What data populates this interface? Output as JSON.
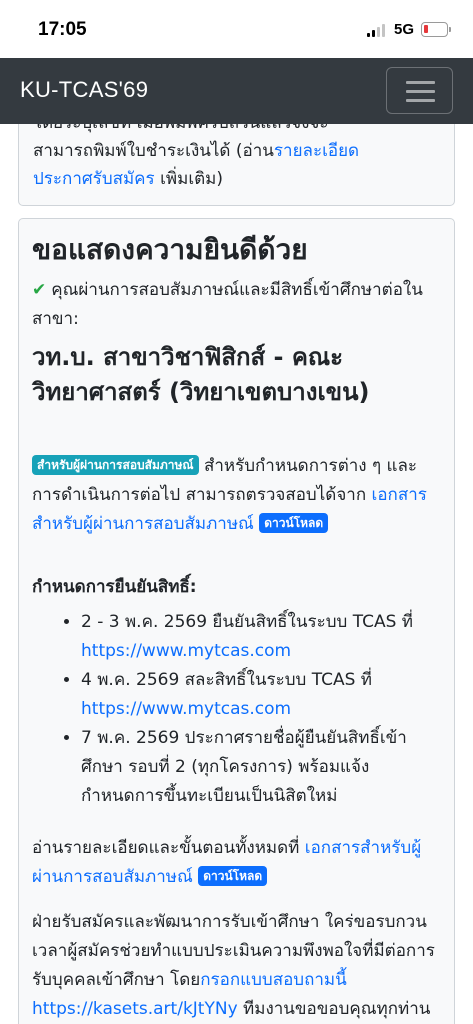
{
  "status": {
    "time": "17:05",
    "network": "5G"
  },
  "navbar": {
    "brand": "KU-TCAS'69"
  },
  "notice": {
    "line1": "โดยระบุเลขที่ เมื่อพิมพ์ครบถ้วนแล้วจึงจะ",
    "line2_pre": "สามารถพิมพ์ใบชำระเงินได้ (อ่าน",
    "line2_link": "รายละเอียด",
    "line3_link": "ประกาศรับสมัคร",
    "line3_post": " เพิ่มเติม)"
  },
  "result": {
    "title": "ขอแสดงความยินดีด้วย",
    "passed_text": "คุณผ่านการสอบสัมภาษณ์และมีสิทธิ์เข้าศึกษาต่อในสาขา:",
    "program": "วท.บ. สาขาวิชาฟิสิกส์ - คณะวิทยาศาสตร์ (วิทยาเขตบางเขน)"
  },
  "docs": {
    "badge": "สำหรับผู้ผ่านการสอบสัมภาษณ์",
    "text": " สำหรับกำหนดการต่าง ๆ และการดำเนินการต่อไป สามารถตรวจสอบได้จาก ",
    "link": "เอกสารสำหรับผู้ผ่านการสอบสัมภาษณ์",
    "download": "ดาวน์โหลด"
  },
  "schedule": {
    "heading": "กำหนดการยืนยันสิทธิ์:",
    "item1_text": "2 - 3 พ.ค. 2569 ยืนยันสิทธิ์ในระบบ TCAS ที่ ",
    "item1_link": "https://www.mytcas.com",
    "item2_text": "4 พ.ค. 2569 สละสิทธิ์ในระบบ TCAS ที่ ",
    "item2_link": "https://www.mytcas.com",
    "item3_text": "7 พ.ค. 2569 ประกาศรายชื่อผู้ยืนยันสิทธิ์เข้าศึกษา รอบที่ 2 (ทุกโครงการ) พร้อมแจ้งกำหนดการขึ้นทะเบียนเป็นนิสิตใหม่"
  },
  "readall": {
    "text": "อ่านรายละเอียดและขั้นตอนทั้งหมดที่ ",
    "link": "เอกสารสำหรับผู้ผ่านการสอบสัมภาษณ์",
    "download": "ดาวน์โหลด"
  },
  "survey": {
    "text": "ฝ่ายรับสมัครและพัฒนาการรับเข้าศึกษา ใคร่ขอรบกวนเวลาผู้สมัครช่วยทำแบบประเมินความพึงพอใจที่มีต่อการรับบุคคลเข้าศึกษา โดย",
    "link": "กรอกแบบสอบถามนี้",
    "url": " https://kasets.art/kJtYNy",
    "post": " ทีมงานขอขอบคุณทุกท่าน"
  }
}
